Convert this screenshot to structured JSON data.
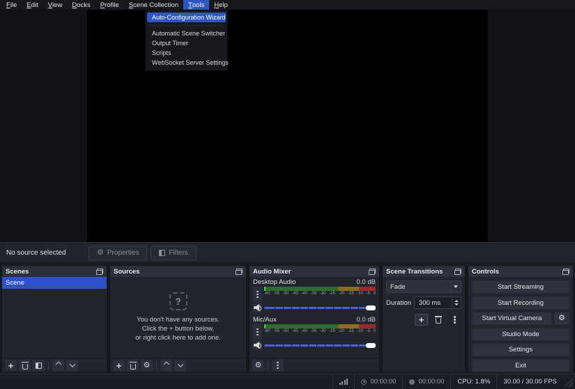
{
  "menubar": {
    "items": [
      {
        "m": "F",
        "rest": "ile"
      },
      {
        "m": "E",
        "rest": "dit"
      },
      {
        "m": "V",
        "rest": "iew"
      },
      {
        "m": "D",
        "rest": "ocks"
      },
      {
        "m": "P",
        "rest": "rofile"
      },
      {
        "m": "S",
        "rest": "cene Collection"
      },
      {
        "m": "T",
        "rest": "ools"
      },
      {
        "m": "H",
        "rest": "elp"
      }
    ]
  },
  "tools_menu": {
    "highlighted_index": 0,
    "items": [
      "Auto-Configuration Wizard",
      "Automatic Scene Switcher",
      "Output Timer",
      "Scripts",
      "WebSocket Server Settings"
    ]
  },
  "context_toolbar": {
    "status": "No source selected",
    "properties_label": "Properties",
    "filters_label": "Filters"
  },
  "scenes": {
    "title": "Scenes",
    "items": [
      "Scene"
    ],
    "selected": "Scene"
  },
  "sources": {
    "title": "Sources",
    "empty_icon": "?",
    "empty_lines": [
      "You don't have any sources.",
      "Click the + button below,",
      "or right click here to add one."
    ]
  },
  "audio_mixer": {
    "title": "Audio Mixer",
    "channels": [
      {
        "name": "Desktop Audio",
        "level": "0.0 dB"
      },
      {
        "name": "Mic/Aux",
        "level": "0.0 dB"
      }
    ],
    "meter_ticks": [
      "-60",
      "-55",
      "-50",
      "-45",
      "-40",
      "-35",
      "-30",
      "-25",
      "-20",
      "-15",
      "-10",
      "-5",
      "0"
    ]
  },
  "scene_transitions": {
    "title": "Scene Transitions",
    "transition": "Fade",
    "duration_label": "Duration",
    "duration_value": "300 ms"
  },
  "controls": {
    "title": "Controls",
    "buttons": [
      "Start Streaming",
      "Start Recording",
      "Start Virtual Camera",
      "Studio Mode",
      "Settings",
      "Exit"
    ]
  },
  "status_bar": {
    "stream_time": "00:00:00",
    "record_time": "00:00:00",
    "cpu": "CPU: 1.8%",
    "fps": "30.00 / 30.00 FPS"
  },
  "colors": {
    "accent_blue": "#2f57c4",
    "scene_selected_blue": "#2f51c8",
    "meter_green": "#2c6e2e",
    "meter_yellow": "#8c6d1c",
    "meter_red": "#9c2a26",
    "slider_blue": "#4a5fd9"
  }
}
